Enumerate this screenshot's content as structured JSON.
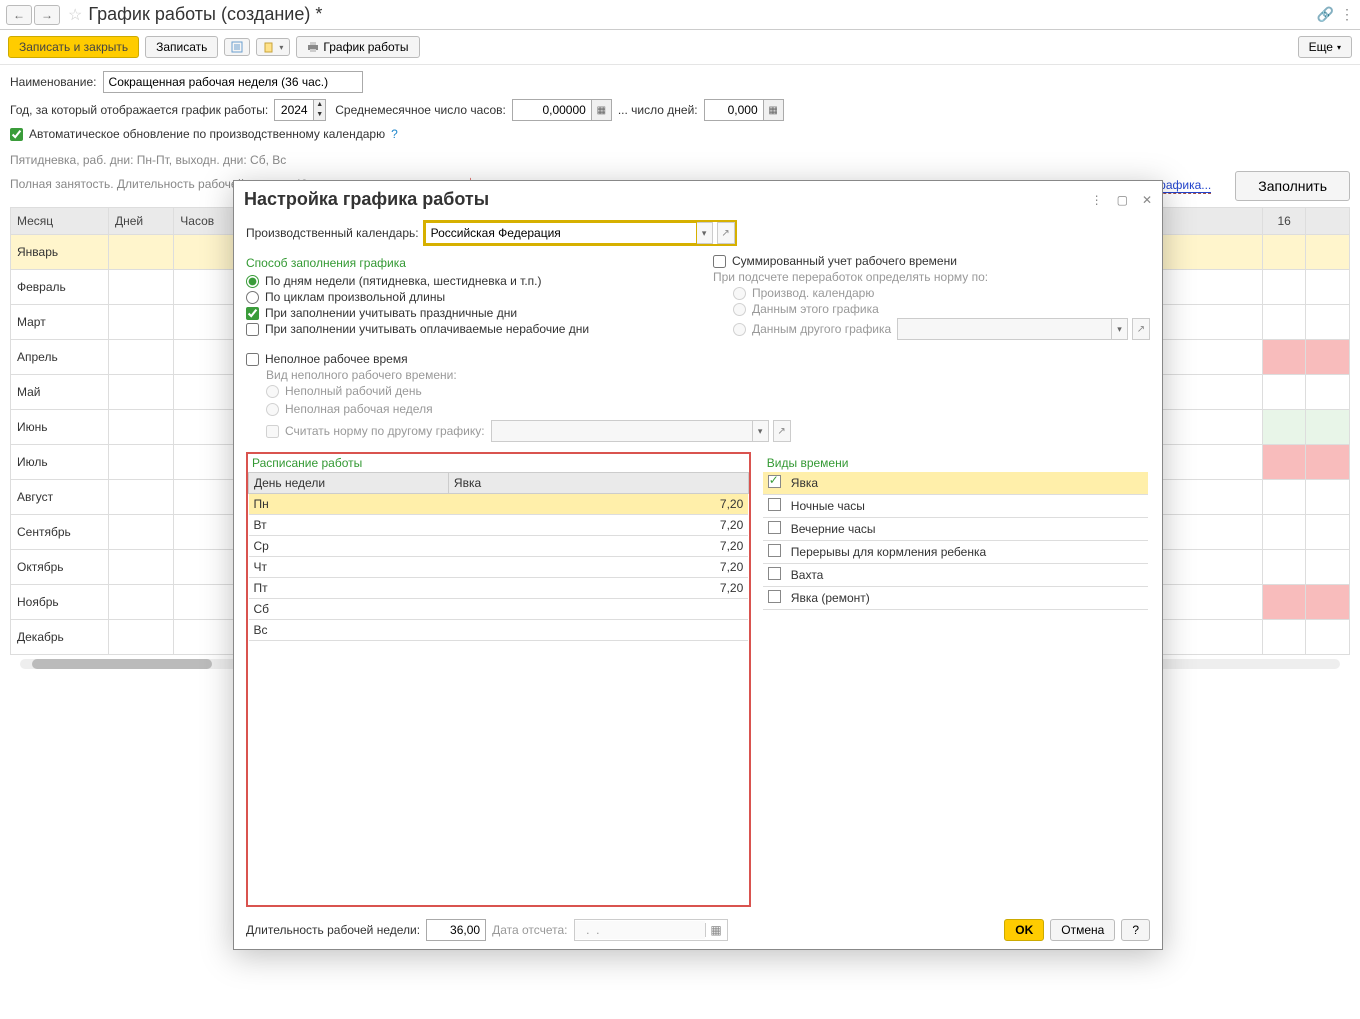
{
  "header": {
    "title": "График работы (создание) *"
  },
  "toolbar": {
    "save_close": "Записать и закрыть",
    "save": "Записать",
    "print_btn": "График работы",
    "more": "Еще"
  },
  "form": {
    "name_lbl": "Наименование:",
    "name_val": "Сокращенная рабочая неделя (36 час.)",
    "year_lbl": "Год, за который отображается график работы:",
    "year_val": "2024",
    "avg_hours_lbl": "Среднемесячное число часов:",
    "avg_hours_val": "0,00000",
    "days_lbl": "... число дней:",
    "days_val": "0,000",
    "auto_upd": "Автоматическое обновление по производственному календарю",
    "summary1": "Пятидневка, раб. дни: Пн-Пт, выходн. дни: Сб, Вс",
    "summary2": "Полная занятость. Длительность рабочей недели: 40 чс.",
    "change_props": "Изменить свойства графика...",
    "fill_btn": "Заполнить"
  },
  "month_cols": {
    "c1": "Месяц",
    "c2": "Дней",
    "c3": "Часов",
    "hdr_day": "16"
  },
  "months": [
    "Январь",
    "Февраль",
    "Март",
    "Апрель",
    "Май",
    "Июнь",
    "Июль",
    "Август",
    "Сентябрь",
    "Октябрь",
    "Ноябрь",
    "Декабрь"
  ],
  "modal": {
    "title": "Настройка графика работы",
    "calendar_lbl": "Производственный календарь:",
    "calendar_val": "Российская Федерация",
    "fill_mode_title": "Способ заполнения графика",
    "opt_weekdays": "По дням недели (пятидневка, шестидневка и т.п.)",
    "opt_cycles": "По циклам произвольной длины",
    "chk_holidays": "При заполнении учитывать праздничные дни",
    "chk_paid_nonwork": "При заполнении учитывать оплачиваемые нерабочие дни",
    "sum_time": "Суммированный учет рабочего времени",
    "norm_lbl": "При подсчете переработок определять норму по:",
    "norm_opt1": "Производ. календарю",
    "norm_opt2": "Данным этого графика",
    "norm_opt3": "Данным другого графика",
    "partial_title": "Неполное рабочее время",
    "partial_kind_lbl": "Вид неполного рабочего времени:",
    "partial_day": "Неполный рабочий день",
    "partial_week": "Неполная рабочая неделя",
    "norm_other": "Считать норму по другому графику:",
    "schedule_title": "Расписание работы",
    "sched_col1": "День недели",
    "sched_col2": "Явка",
    "days": [
      {
        "d": "Пн",
        "v": "7,20"
      },
      {
        "d": "Вт",
        "v": "7,20"
      },
      {
        "d": "Ср",
        "v": "7,20"
      },
      {
        "d": "Чт",
        "v": "7,20"
      },
      {
        "d": "Пт",
        "v": "7,20"
      },
      {
        "d": "Сб",
        "v": ""
      },
      {
        "d": "Вс",
        "v": ""
      }
    ],
    "kinds_title": "Виды времени",
    "kinds": [
      {
        "n": "Явка",
        "c": true
      },
      {
        "n": "Ночные часы",
        "c": false
      },
      {
        "n": "Вечерние часы",
        "c": false
      },
      {
        "n": "Перерывы для кормления ребенка",
        "c": false
      },
      {
        "n": "Вахта",
        "c": false
      },
      {
        "n": "Явка (ремонт)",
        "c": false
      }
    ],
    "week_len_lbl": "Длительность рабочей недели:",
    "week_len_val": "36,00",
    "startdate_lbl": "Дата отсчета:",
    "startdate_val": "  .  .  ",
    "ok": "OK",
    "cancel": "Отмена",
    "help": "?"
  },
  "right_cal_pattern": [
    "ysel",
    "",
    "",
    "red",
    "",
    "green",
    "red",
    "",
    "",
    "",
    "red",
    "",
    "red",
    "",
    "",
    "",
    "",
    "red"
  ]
}
